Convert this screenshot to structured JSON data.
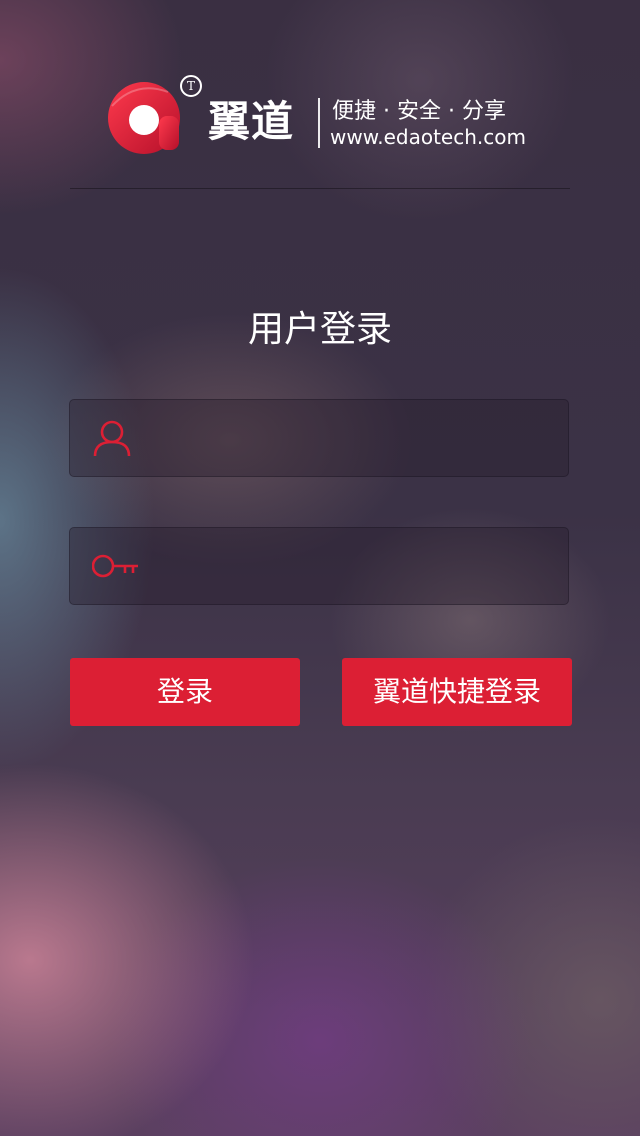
{
  "header": {
    "brand": "翼道",
    "trademark": "T",
    "slogan": "便捷 · 安全 · 分享",
    "website": "www.edaotech.com"
  },
  "page": {
    "title": "用户登录"
  },
  "form": {
    "username": {
      "value": "",
      "placeholder": ""
    },
    "password": {
      "value": "",
      "placeholder": ""
    }
  },
  "buttons": {
    "login": "登录",
    "quick_login": "翼道快捷登录"
  },
  "icons": {
    "logo": "edao-a-logo",
    "user": "user-icon",
    "key": "key-icon"
  },
  "colors": {
    "accent": "#dc1f34",
    "text": "#ffffff"
  }
}
